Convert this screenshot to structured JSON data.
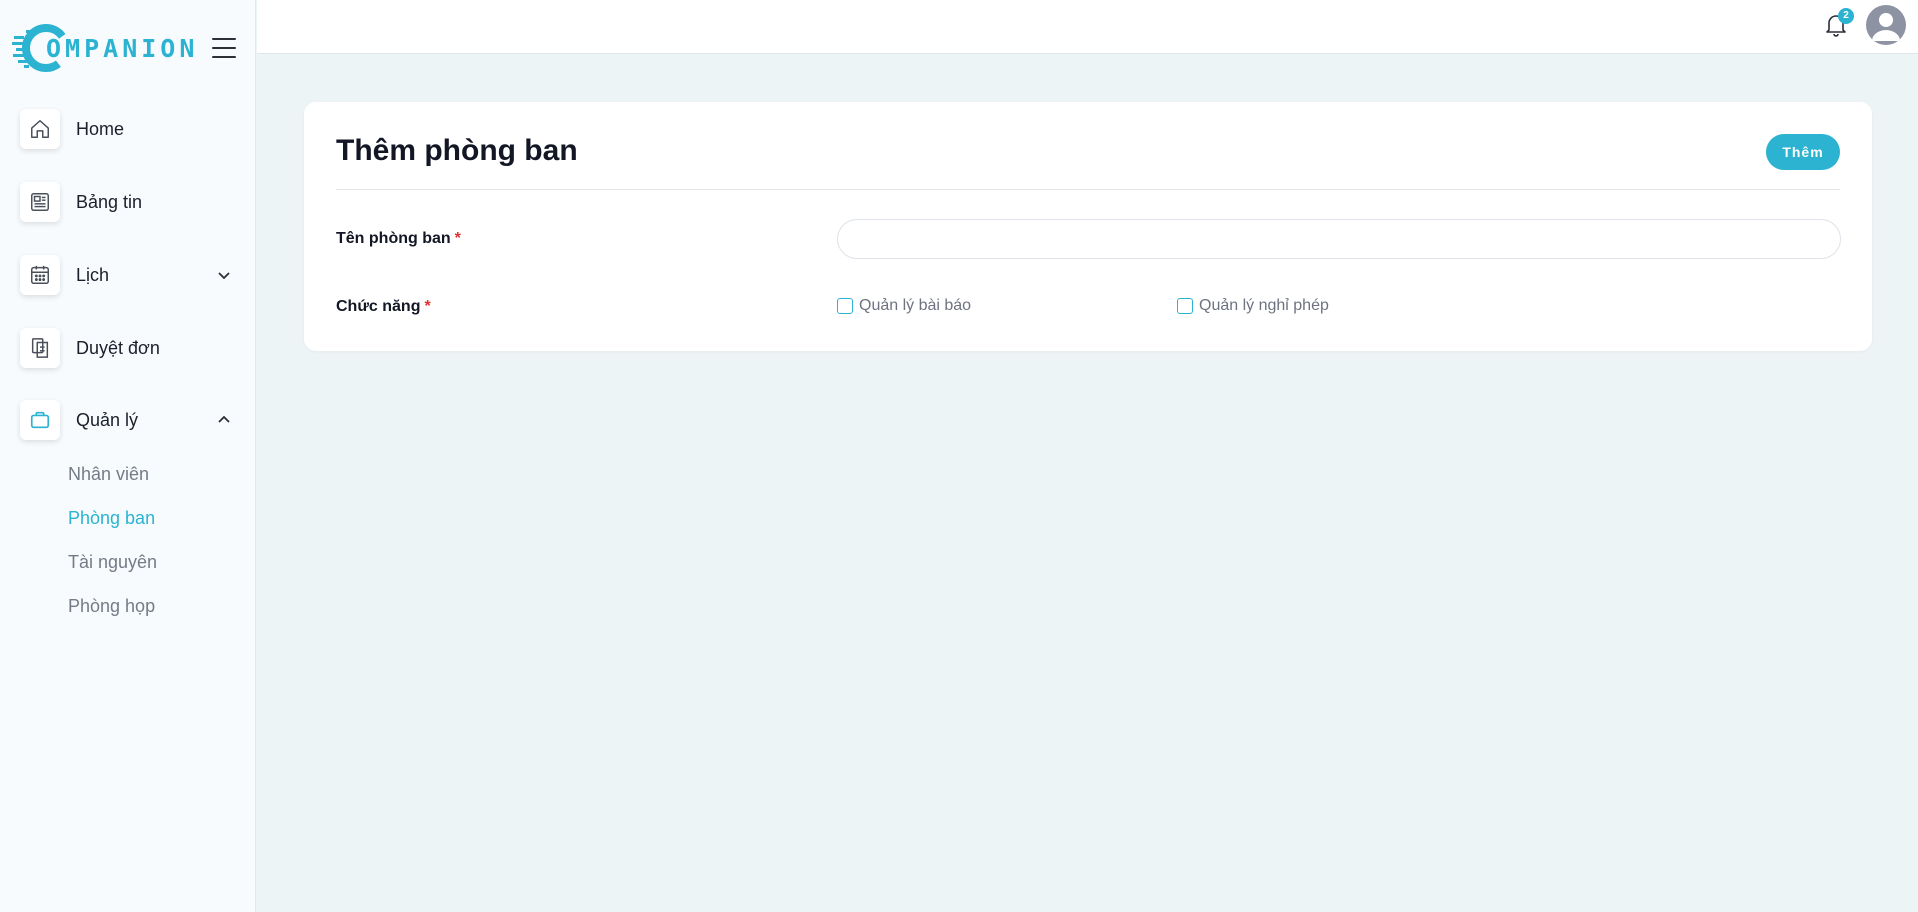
{
  "brand": {
    "name": "OMPANION",
    "accent": "#2bb3d1"
  },
  "sidebar": {
    "items": [
      {
        "label": "Home",
        "icon": "home-icon"
      },
      {
        "label": "Bảng tin",
        "icon": "newspaper-icon"
      },
      {
        "label": "Lịch",
        "icon": "calendar-icon",
        "chevron": "chevron-down-icon"
      },
      {
        "label": "Duyệt đơn",
        "icon": "documents-icon"
      },
      {
        "label": "Quản lý",
        "icon": "briefcase-icon",
        "chevron": "chevron-up-icon",
        "active": true
      }
    ],
    "subitems": [
      {
        "label": "Nhân viên"
      },
      {
        "label": "Phòng ban",
        "active": true
      },
      {
        "label": "Tài nguyên"
      },
      {
        "label": "Phòng họp"
      }
    ]
  },
  "header": {
    "notification_count": "2"
  },
  "form": {
    "title": "Thêm phòng ban",
    "submit_label": "Thêm",
    "name_label": "Tên phòng ban",
    "name_value": "",
    "functions_label": "Chức năng",
    "required_mark": "*",
    "options": [
      {
        "label": "Quản lý bài báo",
        "checked": false
      },
      {
        "label": "Quản lý nghỉ phép",
        "checked": false
      }
    ]
  }
}
